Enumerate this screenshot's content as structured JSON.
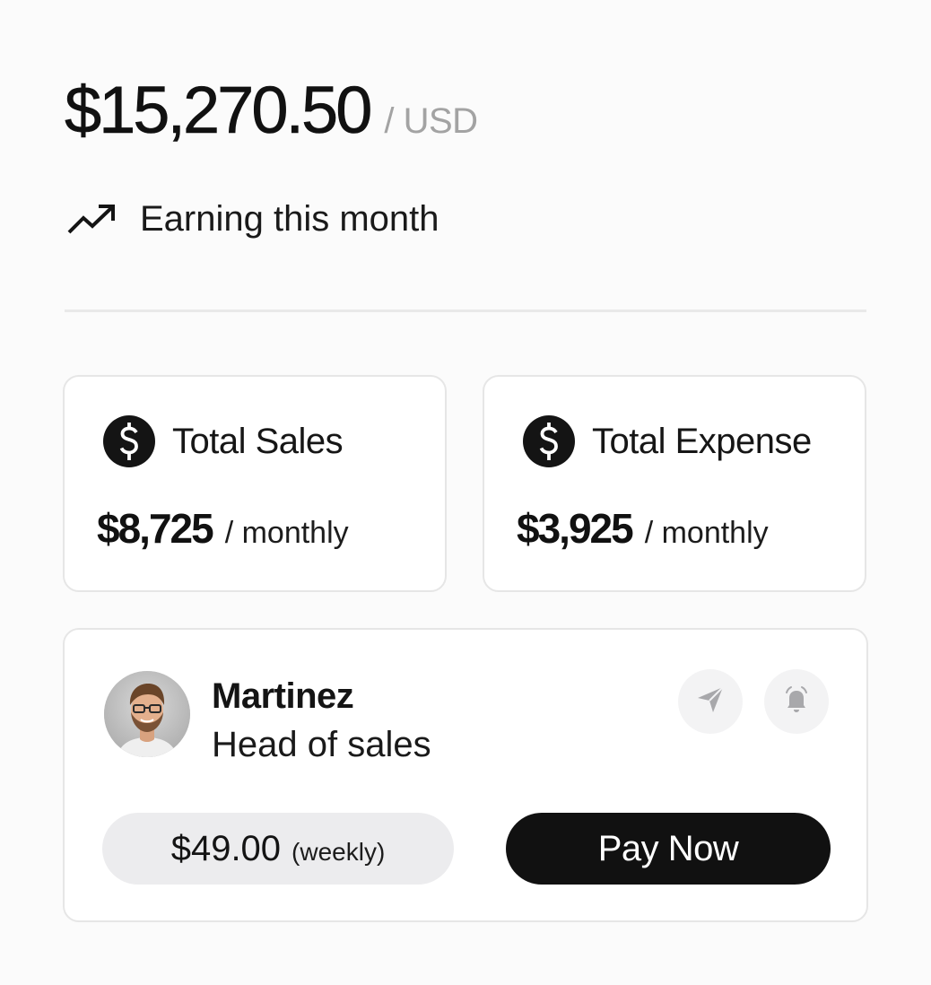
{
  "balance": {
    "amount": "$15,270.50",
    "currency": "/ USD"
  },
  "earning": {
    "icon": "trending-up-icon",
    "label": "Earning this month"
  },
  "stats": [
    {
      "icon": "dollar-circle-icon",
      "label": "Total Sales",
      "value": "$8,725",
      "period": "/ monthly"
    },
    {
      "icon": "dollar-circle-icon",
      "label": "Total Expense",
      "value": "$3,925",
      "period": "/ monthly"
    }
  ],
  "person": {
    "name": "Martinez",
    "role": "Head of sales",
    "actions": {
      "send_icon": "send-icon",
      "bell_icon": "bell-icon"
    }
  },
  "payment": {
    "price": "$49.00",
    "period": "(weekly)",
    "button_label": "Pay Now"
  },
  "colors": {
    "background": "#fbfbfb",
    "text": "#111111",
    "muted": "#a3a3a3",
    "border": "#e6e6e6",
    "pill": "#ececee",
    "button": "#111111",
    "button_text": "#ffffff"
  }
}
